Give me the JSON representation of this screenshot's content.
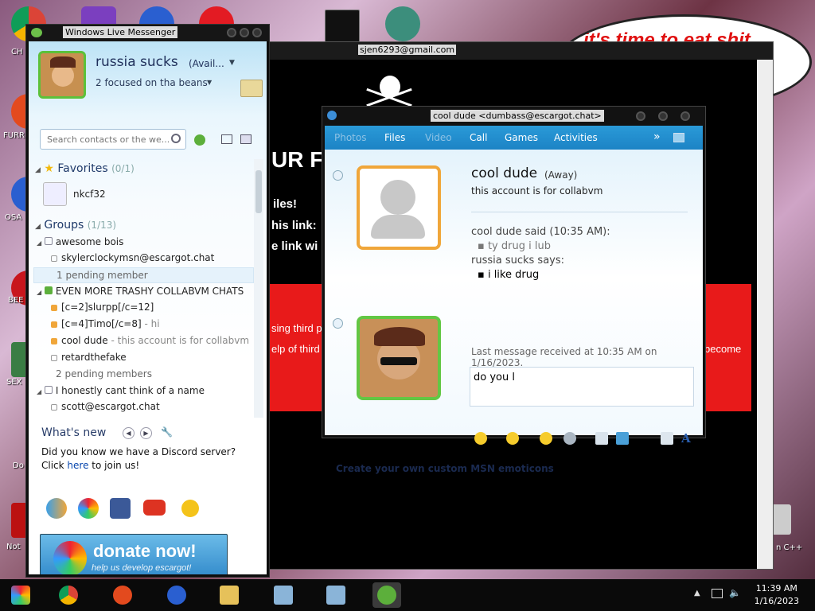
{
  "desktop": {
    "icons": [
      {
        "label": "CH\nD",
        "color": "#db4437"
      },
      {
        "label": "FURR",
        "color": "#e34a1e"
      },
      {
        "label": "OSA\nLAD",
        "color": "#2a5fd0"
      },
      {
        "label": "BEE",
        "color": "#c8161d"
      },
      {
        "label": "SEX",
        "color": "#3a7d44"
      },
      {
        "label": "Do",
        "color": "#555"
      },
      {
        "label": "Not",
        "color": "#b11"
      }
    ],
    "email_label": "sjen6293@gmail.com",
    "bubble_text": "it's time to eat shit",
    "bubble_side": "te",
    "bg_heading": "UR FI",
    "bg_line1": "iles!",
    "bg_line2": "his link:",
    "bg_line3": "e link wi",
    "bg_red1": "sing third p",
    "bg_red2": "elp of third",
    "bg_red3": "become",
    "recycle_label": "n C++"
  },
  "messenger": {
    "title": "Windows Live Messenger",
    "user_name": "russia sucks",
    "user_status": "(Avail...",
    "personal_message": "2 focused on tha beans",
    "search_placeholder": "Search contacts or the we...",
    "favorites_label": "Favorites",
    "favorites_count": "(0/1)",
    "favorite_contact": "nkcf32",
    "groups_label": "Groups",
    "groups_count": "(1/13)",
    "groups": [
      {
        "name": "awesome bois"
      },
      {
        "name": "EVEN MORE TRASHY COLLABVM CHATS"
      },
      {
        "name": "I honestly cant think of a name"
      }
    ],
    "contacts": [
      {
        "name": "skylerclockymsn@escargot.chat",
        "pm": ""
      },
      {
        "name": "[c=2]slurpp[/c=12]",
        "pm": ""
      },
      {
        "name": "[c=4]Timo[/c=8]",
        "pm": " - hi"
      },
      {
        "name": "cool dude",
        "pm": " - this account is for collabvm"
      },
      {
        "name": "retardthefake",
        "pm": ""
      },
      {
        "name": "scott@escargot.chat",
        "pm": ""
      }
    ],
    "pending_1": "1 pending member",
    "pending_2": "2 pending members",
    "whats_new_title": "What's new",
    "whats_new_text": "Did you know we have a Discord server? Click",
    "whats_new_link": "here",
    "whats_new_tail": " to join us!",
    "donate_big": "donate now!",
    "donate_small": "help us develop escargot!"
  },
  "chat": {
    "title": "cool dude <dumbass@escargot.chat>",
    "tabs": [
      {
        "label": "Photos",
        "enabled": false
      },
      {
        "label": "Files",
        "enabled": true
      },
      {
        "label": "Video",
        "enabled": false
      },
      {
        "label": "Call",
        "enabled": true
      },
      {
        "label": "Games",
        "enabled": true
      },
      {
        "label": "Activities",
        "enabled": true
      }
    ],
    "more": "»",
    "contact_name": "cool dude",
    "contact_status": "(Away)",
    "contact_pm": "this account is for collabvm",
    "messages": [
      {
        "kind": "header",
        "text": "cool dude said (10:35 AM):"
      },
      {
        "kind": "line",
        "text": "ty drug i lub"
      },
      {
        "kind": "header",
        "text": "russia sucks says:"
      },
      {
        "kind": "line",
        "text": "i like drug"
      }
    ],
    "last_received": "Last message received at 10:35 AM on 1/16/2023.",
    "input_value": "do you l",
    "footer_link": "Create your own custom MSN emoticons"
  },
  "taskbar": {
    "time": "11:39 AM",
    "date": "1/16/2023"
  },
  "colors": {
    "messenger_blue": "#1c83c5",
    "online_green": "#62c744",
    "away_orange": "#f0a63a"
  }
}
